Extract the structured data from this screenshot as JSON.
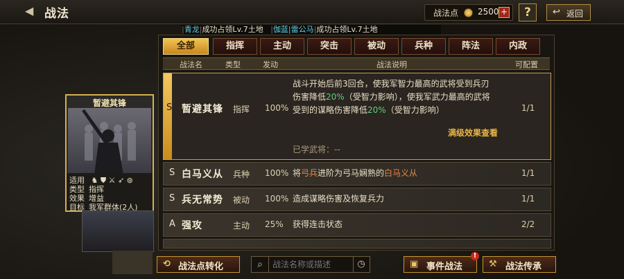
{
  "header": {
    "title": "战法",
    "points_label": "战法点",
    "points_value": "2500",
    "plus": "+",
    "help": "?",
    "back_label": "返回"
  },
  "ticker": {
    "items": [
      {
        "name": "青龙",
        "text": "成功占领Lv.7土地"
      },
      {
        "name": "伽蓝|雷公马",
        "text": "成功占领Lv.7土地"
      }
    ]
  },
  "tabs": [
    "全部",
    "指挥",
    "主动",
    "突击",
    "被动",
    "兵种",
    "阵法",
    "内政"
  ],
  "table_header": {
    "name": "战法名",
    "type": "类型",
    "trigger": "发动",
    "desc": "战法说明",
    "config": "可配置"
  },
  "rows": [
    {
      "rarity": "S",
      "name": "暂避其锋",
      "type": "指挥",
      "trigger": "100%",
      "desc_parts": [
        "战斗开始后前3回合，使我军智力最高的武将受到兵刃",
        "伤害降低",
        "20%",
        "（受智力影响），使我军武力最高的武将",
        "受到的谋略伤害降低",
        "20%",
        "（受智力影响）"
      ],
      "config": "1/1",
      "see_more": "满级效果查看",
      "learned": "已学武将：--"
    },
    {
      "rarity": "S",
      "name": "白马义从",
      "type": "兵种",
      "trigger": "100%",
      "desc_parts": [
        "将",
        "弓兵",
        "进阶为弓马娴熟的",
        "白马义从"
      ],
      "config": "1/1"
    },
    {
      "rarity": "S",
      "name": "兵无常势",
      "type": "被动",
      "trigger": "100%",
      "desc": "造成谋略伤害及恢复兵力",
      "config": "1/1"
    },
    {
      "rarity": "A",
      "name": "强攻",
      "type": "主动",
      "trigger": "25%",
      "desc": "获得连击状态",
      "config": "2/2"
    }
  ],
  "card": {
    "title": "暂避其锋",
    "apply_label": "适用",
    "type_label": "类型",
    "type_value": "指挥",
    "effect_label": "效果",
    "effect_value": "增益",
    "target_label": "目标",
    "target_value": "我军群体(2人)"
  },
  "bottom": {
    "convert_label": "战法点转化",
    "search_placeholder": "战法名称或描述",
    "event_label": "事件战法",
    "event_badge": "!",
    "inherit_label": "战法传承"
  }
}
